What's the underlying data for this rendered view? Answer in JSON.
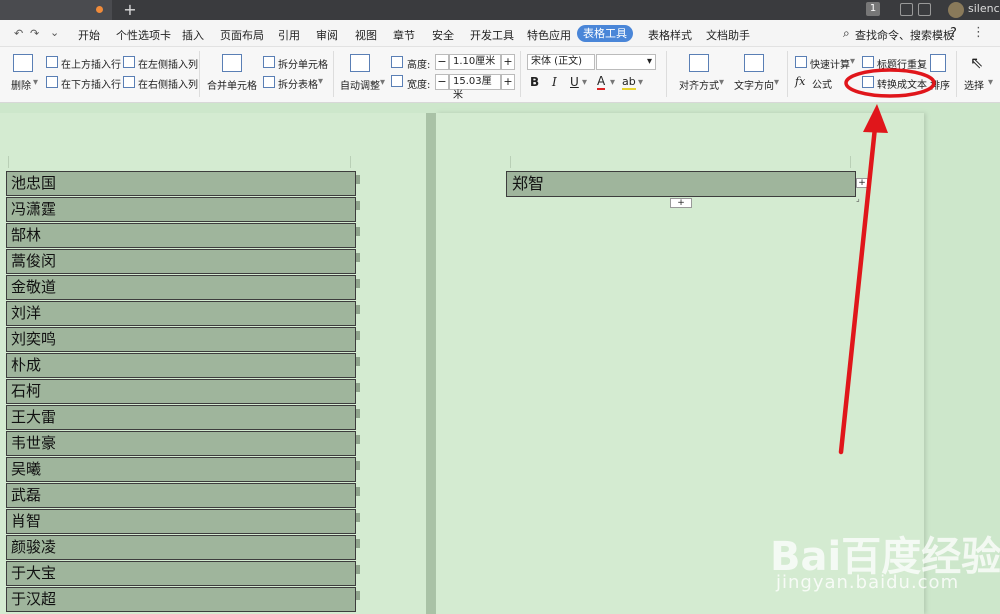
{
  "titlebar": {
    "badge": "1",
    "username": "silence",
    "new_tab": "+"
  },
  "menu": {
    "items": [
      "开始",
      "个性选项卡",
      "插入",
      "页面布局",
      "引用",
      "审阅",
      "视图",
      "章节",
      "安全",
      "开发工具",
      "特色应用",
      "表格工具",
      "表格样式",
      "文档助手"
    ],
    "active": "表格工具",
    "search": "查找命令、搜索模板",
    "help": "?"
  },
  "ribbon": {
    "delete": "删除",
    "insert_above": "在上方插入行",
    "insert_below": "在下方插入行",
    "insert_left": "在左侧插入列",
    "insert_right": "在右侧插入列",
    "merge": "合并单元格",
    "split_cell": "拆分单元格",
    "split_table": "拆分表格",
    "autofit": "自动调整",
    "height_label": "高度:",
    "height_value": "1.10厘米",
    "width_label": "宽度:",
    "width_value": "15.03厘米",
    "font_name": "宋体 (正文)",
    "bold": "B",
    "italic": "I",
    "underline": "U",
    "font_color": "A",
    "highlight": "ab",
    "align": "对齐方式",
    "text_direction": "文字方向",
    "quick_calc": "快速计算",
    "formula": "公式",
    "formula_icon": "fx",
    "repeat_header": "标题行重复",
    "convert_to_text": "转换成文本",
    "sort": "排序",
    "select": "选择"
  },
  "document": {
    "left_table": [
      "池忠国",
      "冯潇霆",
      "郜林",
      "蒿俊闵",
      "金敬道",
      "刘洋",
      "刘奕鸣",
      "朴成",
      "石柯",
      "王大雷",
      "韦世豪",
      "吴曦",
      "武磊",
      "肖智",
      "颜骏凌",
      "于大宝",
      "于汉超"
    ],
    "right_table": [
      "郑智"
    ]
  },
  "watermark": {
    "brand": "Bai百度经验",
    "url": "jingyan.baidu.com"
  },
  "colors": {
    "accent": "#4a86d8",
    "annotation": "#e0161b",
    "cell_bg": "#9fb59c",
    "page_bg": "#d4ebd1"
  }
}
